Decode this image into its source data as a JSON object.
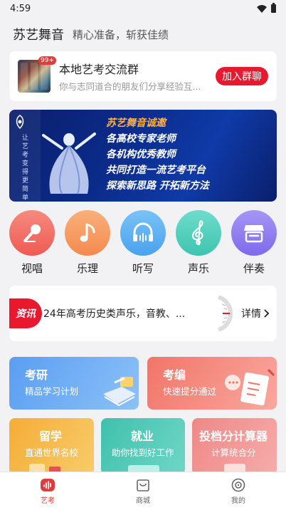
{
  "status": {
    "time": "4:59"
  },
  "header": {
    "title": "苏艺舞音",
    "slogan": "精心准备，斩获佳绩"
  },
  "group_card": {
    "badge": "99+",
    "title": "本地艺考交流群",
    "desc": "你与志同道合的朋友们分享经验互...",
    "join_label": "加入群聊"
  },
  "banner": {
    "lines": [
      "苏艺舞音诚邀",
      "各高校专家老师",
      "各机构优秀教师",
      "共同打造一流艺考平台",
      "探索新思路 开拓新方法"
    ],
    "vertical_text": "让艺考变得更简单"
  },
  "categories": [
    {
      "label": "视唱",
      "color": "#f2675f",
      "icon": "microphone-icon"
    },
    {
      "label": "乐理",
      "color": "#f7995a",
      "icon": "music-note-icon"
    },
    {
      "label": "听写",
      "color": "#5ab1f2",
      "icon": "headphones-icon"
    },
    {
      "label": "声乐",
      "color": "#49d0bd",
      "icon": "treble-clef-icon"
    },
    {
      "label": "伴奏",
      "color": "#8f7cf0",
      "icon": "shop-icon"
    }
  ],
  "news": {
    "tag": "资讯",
    "text": "24年高考历史类声乐，音教、...",
    "more": "详情"
  },
  "cards": [
    {
      "title": "考研",
      "sub": "精品学习计划",
      "c1": "#5fa4f3",
      "c2": "#8ec2f9"
    },
    {
      "title": "考编",
      "sub": "快速提分通过",
      "c1": "#f27a6d",
      "c2": "#f9a79d"
    },
    {
      "title": "留学",
      "sub": "直通世界名校",
      "c1": "#f6b23c",
      "c2": "#f8c866"
    },
    {
      "title": "就业",
      "sub": "助你找到好工作",
      "c1": "#3fc3b0",
      "c2": "#6ad5c4"
    },
    {
      "title": "投档分计算器",
      "sub": "计算统合分",
      "c1": "#f08a8a",
      "c2": "#f6aaa8"
    }
  ],
  "tabbar": [
    {
      "label": "艺考",
      "icon": "music-wave-icon",
      "active": true
    },
    {
      "label": "商城",
      "icon": "mall-icon",
      "active": false
    },
    {
      "label": "我的",
      "icon": "vinyl-record-icon",
      "active": false
    }
  ],
  "colors": {
    "accent_red": "#e8192e",
    "active_tab": "#e23b3b"
  }
}
